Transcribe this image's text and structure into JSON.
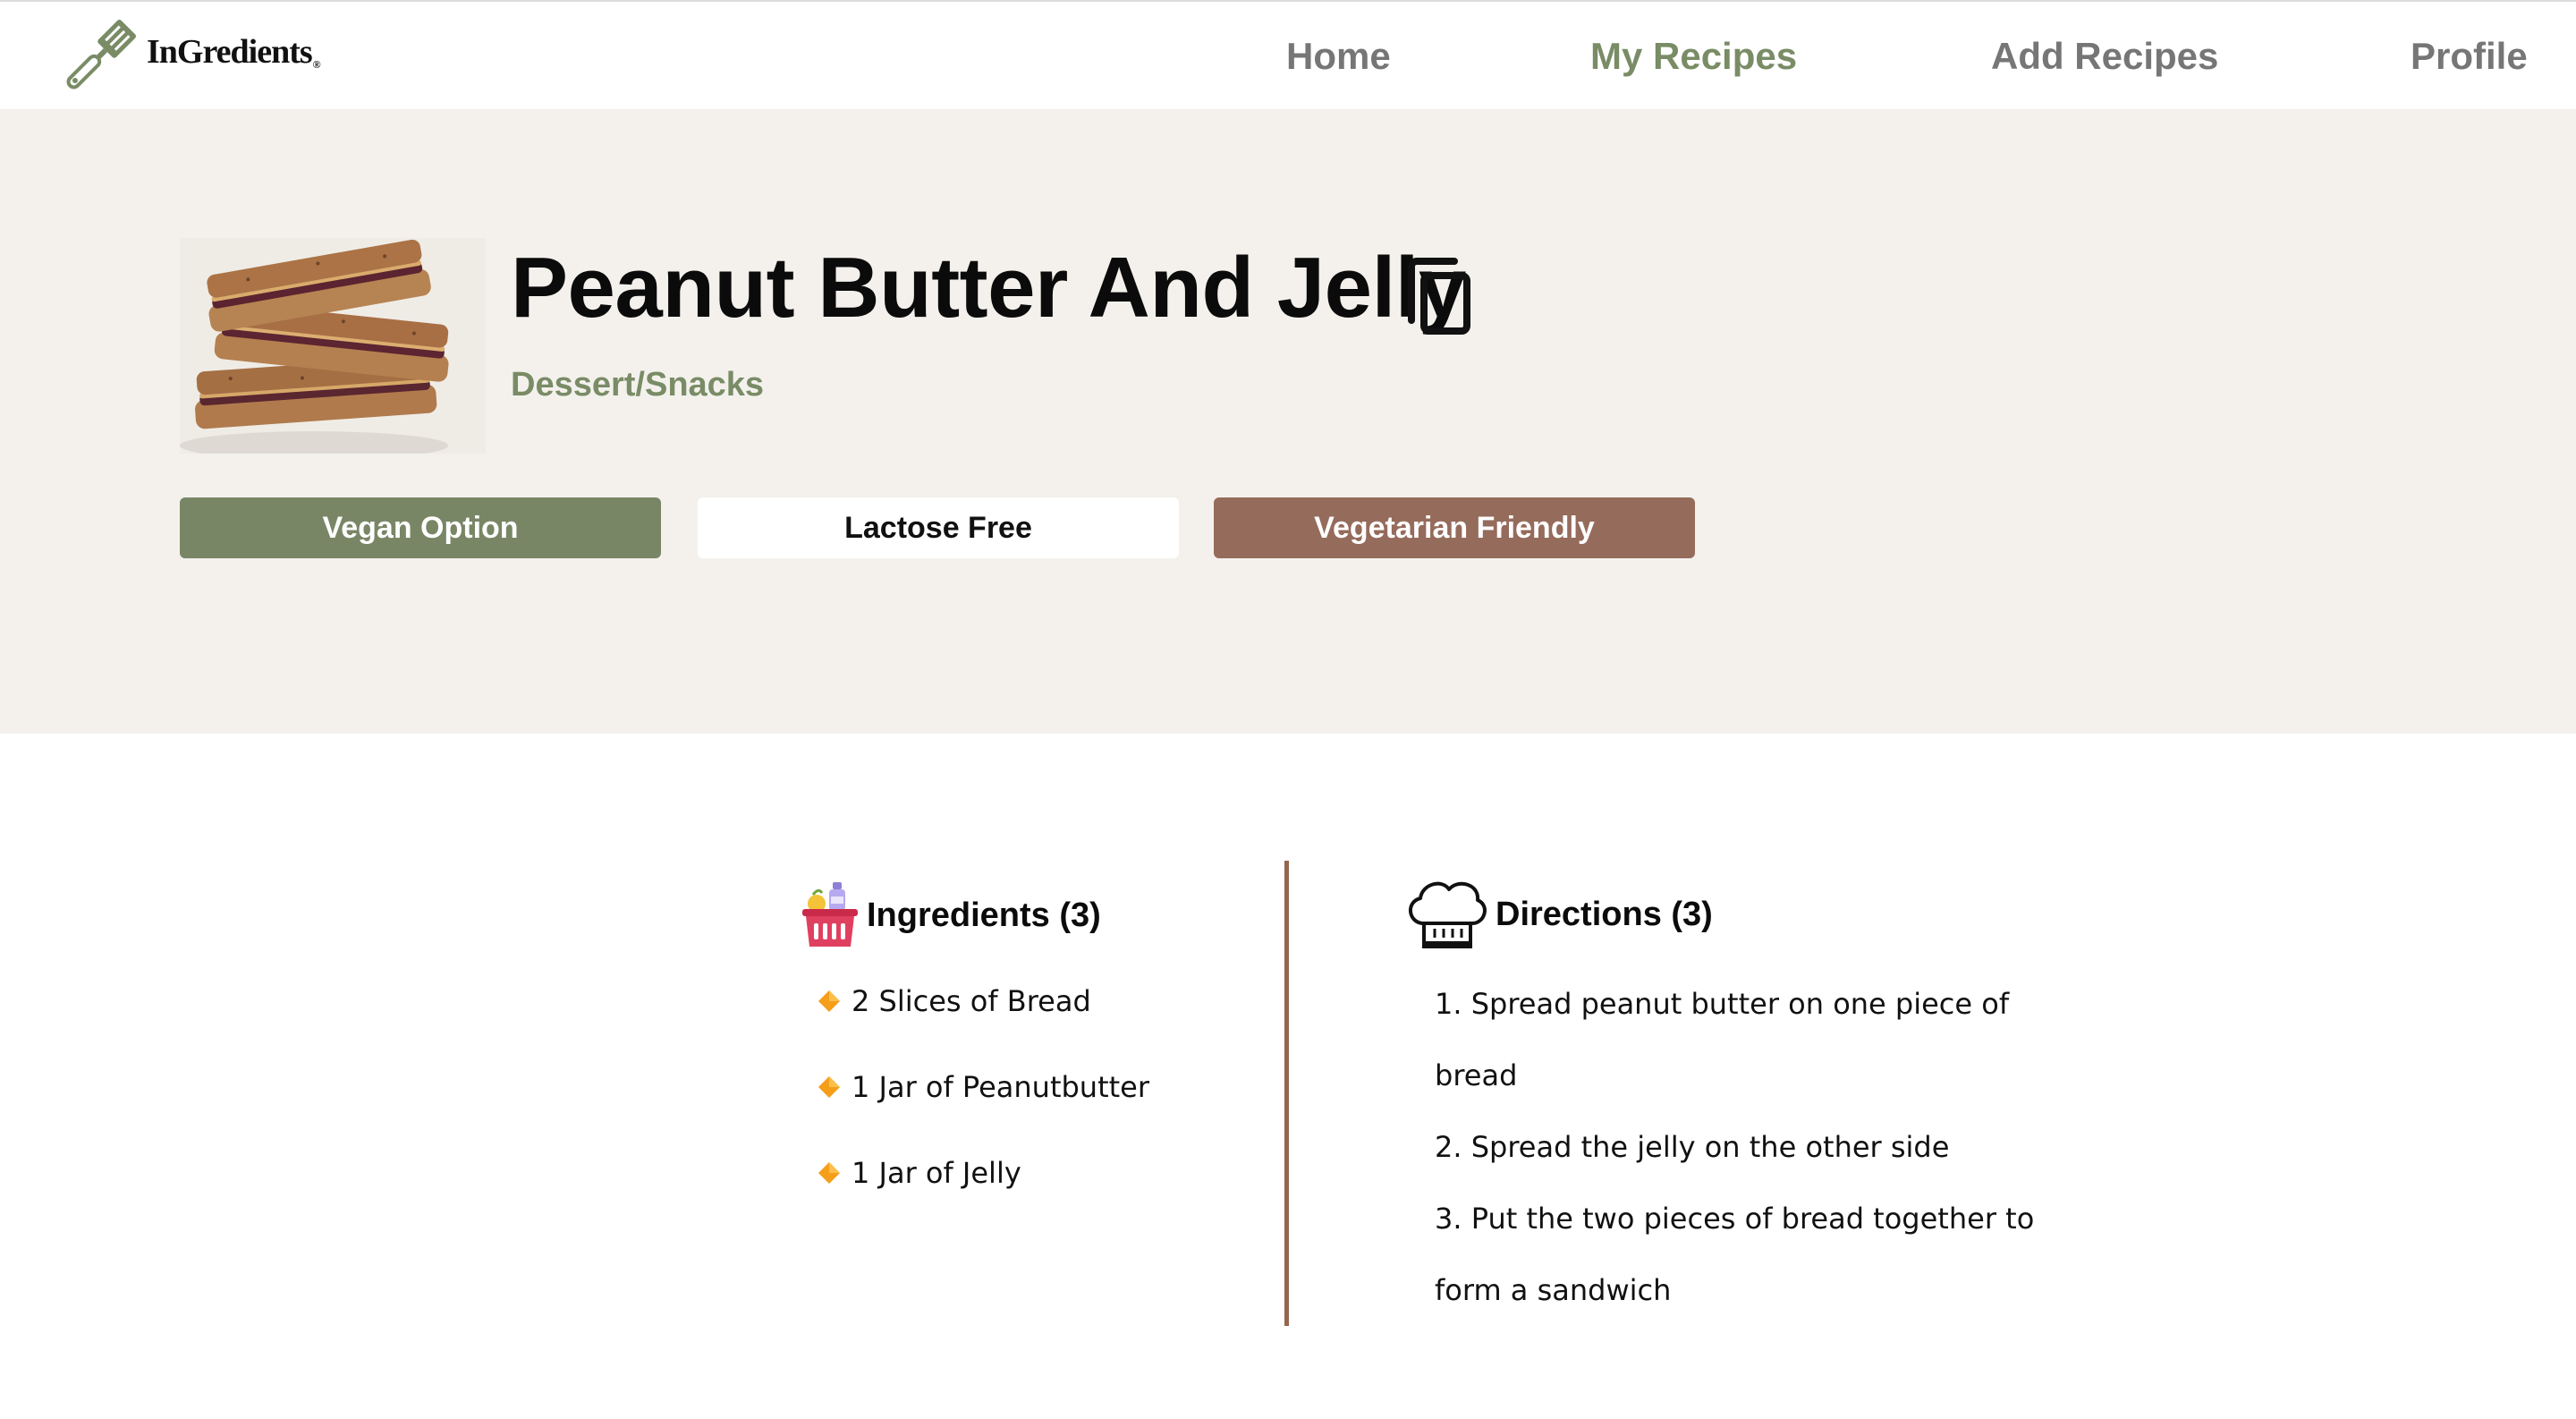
{
  "brand": {
    "name": "InGredients",
    "reg_mark": "®",
    "accent_color": "#798c66"
  },
  "nav": {
    "items": [
      {
        "label": "Home",
        "active": false
      },
      {
        "label": "My Recipes",
        "active": true
      },
      {
        "label": "Add Recipes",
        "active": false
      },
      {
        "label": "Profile",
        "active": false
      }
    ]
  },
  "recipe": {
    "title": "Peanut Butter And Jelly",
    "category": "Dessert/Snacks",
    "photo_icon": "sandwich-photo",
    "tags": [
      {
        "label": "Vegan Option",
        "color": "#798666"
      },
      {
        "label": "Lactose Free",
        "color": "#ffffff"
      },
      {
        "label": "Vegetarian Friendly",
        "color": "#956b5b"
      }
    ]
  },
  "ingredients": {
    "heading": "Ingredients (3)",
    "icon": "grocery-basket-icon",
    "items": [
      "2 Slices of Bread",
      "1 Jar of Peanutbutter",
      "1 Jar of Jelly"
    ]
  },
  "directions": {
    "heading": "Directions (3)",
    "icon": "chef-hat-icon",
    "lines": [
      "1. Spread peanut butter on one piece of",
      "bread",
      "2. Spread the jelly on the other side",
      "3. Put the two pieces of bread together to",
      "form a sandwich"
    ]
  },
  "colors": {
    "hero_background": "#f4f1ed",
    "divider": "#94664f"
  }
}
